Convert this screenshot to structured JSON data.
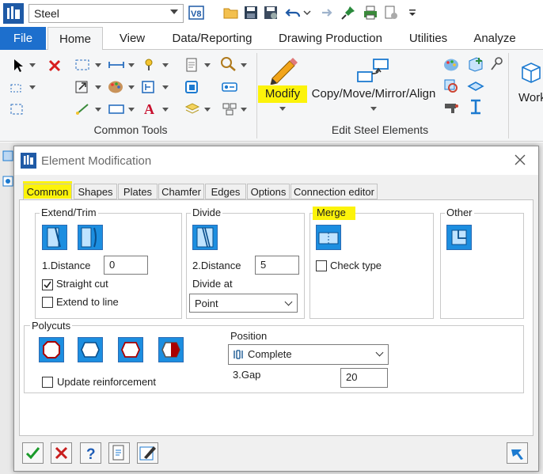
{
  "quick_access": {
    "workset": "Steel"
  },
  "ribbon": {
    "file_tab": "File",
    "tabs": [
      "Home",
      "View",
      "Data/Reporting",
      "Drawing Production",
      "Utilities",
      "Analyze"
    ],
    "active_tab": "Home",
    "groups": {
      "common_tools": "Common Tools",
      "edit_steel": "Edit Steel Elements",
      "modify": "Modify",
      "copy_move": "Copy/Move/Mirror/Align",
      "work_partial": "Work"
    }
  },
  "dialog": {
    "title": "Element Modification",
    "tabs": [
      "Common",
      "Shapes",
      "Plates",
      "Chamfer",
      "Edges",
      "Options",
      "Connection editor"
    ],
    "active_tab": "Common",
    "extend_trim": {
      "title": "Extend/Trim",
      "distance_label": "1.Distance",
      "distance_value": "0",
      "straight_cut_label": "Straight cut",
      "straight_cut_checked": true,
      "extend_to_line_label": "Extend to line",
      "extend_to_line_checked": false
    },
    "divide": {
      "title": "Divide",
      "distance_label": "2.Distance",
      "distance_value": "5",
      "divide_at_label": "Divide at",
      "divide_at_value": "Point"
    },
    "merge": {
      "title": "Merge",
      "check_type_label": "Check type",
      "check_type_checked": false
    },
    "other": {
      "title": "Other"
    },
    "polycuts": {
      "title": "Polycuts",
      "update_reinforcement_label": "Update reinforcement",
      "update_reinforcement_checked": false,
      "position_label": "Position",
      "position_value": "Complete",
      "gap_label": "3.Gap",
      "gap_value": "20"
    }
  },
  "colors": {
    "accent_blue": "#1d6fcd",
    "highlight": "#fcf30a",
    "icon_blue": "#1c8ee0"
  }
}
